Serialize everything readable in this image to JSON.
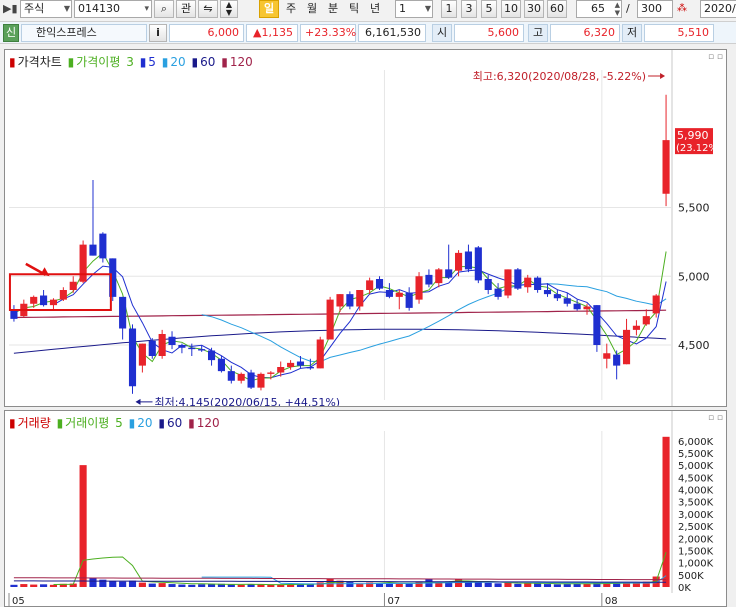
{
  "toolbar": {
    "market_type": "주식",
    "stock_code": "014130",
    "search_btn": "⌕",
    "watch_label": "관",
    "period_day": "일",
    "period_week": "주",
    "period_month": "월",
    "period_minute": "분",
    "period_tick": "틱",
    "period_year": "년",
    "interval_value": "1",
    "interval_options": [
      "1",
      "3",
      "5",
      "10",
      "30",
      "60"
    ],
    "view_count": "65",
    "total_count": "300",
    "date_value": "2020/"
  },
  "infobar": {
    "badge": "신",
    "stock_name": "한익스프레스",
    "info_btn": "i",
    "price": "6,000",
    "change": "▲1,135",
    "change_rate": "+23.33%",
    "volume": "6,161,530",
    "open_label": "시",
    "open_value": "5,600",
    "high_label": "고",
    "high_value": "6,320",
    "low_label": "저",
    "low_value": "5,510"
  },
  "price_panel": {
    "legend_price": "가격차트",
    "legend_ma_name": "가격이평",
    "legend_ma_periods": [
      "3",
      "5",
      "20",
      "60",
      "120"
    ]
  },
  "volume_panel": {
    "legend_volume": "거래량",
    "legend_ma_name": "거래이평",
    "legend_ma_periods": [
      "5",
      "20",
      "60",
      "120"
    ]
  },
  "colors": {
    "up": "#e8232a",
    "down": "#1f2fd0",
    "ma3": "#4caf20",
    "ma5": "#1f2fd0",
    "ma20": "#2aa0e0",
    "ma60": "#1a1a8a",
    "ma120": "#a0234a",
    "annotation": "#c0202a"
  },
  "chart_data": [
    {
      "type": "candlestick",
      "title": "가격차트",
      "yaxis_ticks": [
        "5,500",
        "5,000",
        "4,500"
      ],
      "ylim": [
        4100,
        6500
      ],
      "xaxis_ticks": [
        "05",
        "07",
        "08"
      ],
      "last_price_label": "5,990",
      "last_change_label": "(23.12%)",
      "high_annotation": "최고:6,320(2020/08/28, -5.22%)",
      "low_annotation": "최저:4,145(2020/06/15, +44.51%)",
      "series": [
        {
          "name": "price",
          "ohlc": [
            [
              4760,
              4790,
              4670,
              4690
            ],
            [
              4710,
              4830,
              4700,
              4800
            ],
            [
              4800,
              4860,
              4770,
              4850
            ],
            [
              4860,
              4900,
              4780,
              4790
            ],
            [
              4790,
              4840,
              4760,
              4830
            ],
            [
              4830,
              4920,
              4820,
              4900
            ],
            [
              4900,
              5000,
              4880,
              4960
            ],
            [
              4960,
              5260,
              4950,
              5230
            ],
            [
              5230,
              5700,
              5150,
              5150
            ],
            [
              5310,
              5320,
              5100,
              5130
            ],
            [
              5130,
              5130,
              4820,
              4850
            ],
            [
              4850,
              4850,
              4540,
              4620
            ],
            [
              4620,
              4650,
              4145,
              4200
            ],
            [
              4350,
              4510,
              4300,
              4510
            ],
            [
              4530,
              4550,
              4400,
              4420
            ],
            [
              4420,
              4610,
              4400,
              4580
            ],
            [
              4560,
              4600,
              4470,
              4500
            ],
            [
              4500,
              4510,
              4440,
              4480
            ],
            [
              4480,
              4510,
              4420,
              4470
            ],
            [
              4470,
              4500,
              4450,
              4460
            ],
            [
              4460,
              4480,
              4350,
              4390
            ],
            [
              4400,
              4420,
              4300,
              4310
            ],
            [
              4310,
              4350,
              4220,
              4240
            ],
            [
              4240,
              4300,
              4220,
              4290
            ],
            [
              4300,
              4320,
              4180,
              4190
            ],
            [
              4190,
              4300,
              4170,
              4290
            ],
            [
              4290,
              4310,
              4250,
              4300
            ],
            [
              4300,
              4380,
              4270,
              4340
            ],
            [
              4340,
              4390,
              4320,
              4370
            ],
            [
              4380,
              4420,
              4330,
              4350
            ],
            [
              4340,
              4400,
              4320,
              4330
            ],
            [
              4330,
              4560,
              4330,
              4540
            ],
            [
              4540,
              4850,
              4540,
              4830
            ],
            [
              4780,
              4870,
              4740,
              4870
            ],
            [
              4870,
              4890,
              4760,
              4780
            ],
            [
              4780,
              4900,
              4750,
              4900
            ],
            [
              4900,
              4990,
              4870,
              4970
            ],
            [
              4980,
              5000,
              4900,
              4910
            ],
            [
              4900,
              4950,
              4840,
              4850
            ],
            [
              4850,
              4900,
              4760,
              4880
            ],
            [
              4880,
              4920,
              4750,
              4770
            ],
            [
              4830,
              5030,
              4800,
              5000
            ],
            [
              5010,
              5050,
              4920,
              4940
            ],
            [
              4950,
              5060,
              4920,
              5050
            ],
            [
              5050,
              5230,
              4980,
              4990
            ],
            [
              5040,
              5190,
              5000,
              5170
            ],
            [
              5180,
              5230,
              5030,
              5050
            ],
            [
              5210,
              5220,
              4950,
              4970
            ],
            [
              4980,
              5010,
              4870,
              4900
            ],
            [
              4910,
              4950,
              4830,
              4850
            ],
            [
              4860,
              5050,
              4840,
              5050
            ],
            [
              5050,
              5060,
              4900,
              4910
            ],
            [
              4920,
              5010,
              4880,
              4990
            ],
            [
              4990,
              5000,
              4880,
              4900
            ],
            [
              4900,
              4950,
              4850,
              4870
            ],
            [
              4870,
              4900,
              4820,
              4840
            ],
            [
              4840,
              4880,
              4780,
              4800
            ],
            [
              4800,
              4830,
              4750,
              4760
            ],
            [
              4760,
              4800,
              4720,
              4780
            ],
            [
              4790,
              4790,
              4450,
              4500
            ],
            [
              4400,
              4510,
              4330,
              4440
            ],
            [
              4430,
              4460,
              4250,
              4350
            ],
            [
              4360,
              4690,
              4360,
              4610
            ],
            [
              4610,
              4680,
              4570,
              4640
            ],
            [
              4650,
              4760,
              4640,
              4710
            ],
            [
              4730,
              4870,
              4700,
              4860
            ],
            [
              5600,
              6320,
              5510,
              5990
            ]
          ]
        },
        {
          "name": "3",
          "values": [
            4730,
            4770,
            4780,
            4810,
            4820,
            4840,
            4890,
            5030,
            5110,
            5170,
            5040,
            4870,
            4560,
            4440,
            4380,
            4500,
            4530,
            4520,
            4480,
            4470,
            4440,
            4390,
            4310,
            4280,
            4240,
            4260,
            4260,
            4310,
            4340,
            4350,
            4350,
            4410,
            4570,
            4750,
            4830,
            4850,
            4880,
            4930,
            4910,
            4880,
            4850,
            4880,
            4900,
            4990,
            4990,
            5070,
            5070,
            5060,
            4980,
            4910,
            4930,
            4930,
            4980,
            4930,
            4920,
            4870,
            4840,
            4810,
            4780,
            4680,
            4570,
            4430,
            4470,
            4530,
            4660,
            4740,
            5180
          ]
        }
      ]
    },
    {
      "type": "bar",
      "title": "거래량",
      "yaxis_ticks": [
        "6,000K",
        "5,500K",
        "5,000K",
        "4,500K",
        "4,000K",
        "3,500K",
        "3,000K",
        "2,500K",
        "2,000K",
        "1,500K",
        "1,000K",
        "500K",
        "0K"
      ],
      "ylim": [
        0,
        6400
      ],
      "series": [
        {
          "name": "volume",
          "values": [
            90,
            120,
            100,
            110,
            90,
            130,
            140,
            5000,
            380,
            300,
            250,
            220,
            260,
            180,
            140,
            160,
            120,
            100,
            90,
            110,
            120,
            130,
            100,
            90,
            110,
            100,
            90,
            100,
            110,
            120,
            110,
            190,
            340,
            260,
            200,
            150,
            180,
            160,
            140,
            130,
            140,
            230,
            320,
            170,
            230,
            310,
            210,
            200,
            170,
            150,
            180,
            130,
            160,
            140,
            120,
            110,
            120,
            130,
            140,
            170,
            150,
            140,
            190,
            160,
            220,
            430,
            6162
          ]
        },
        {
          "name": "5",
          "values": [
            null,
            null,
            null,
            null,
            102,
            108,
            112,
            1094,
            1148,
            1190,
            1220,
            1230,
            882,
            242,
            210,
            192,
            172,
            152,
            134,
            132,
            124,
            112,
            106,
            108,
            110,
            106,
            98,
            98,
            102,
            106,
            106,
            126,
            174,
            204,
            226,
            228,
            226,
            208,
            186,
            152,
            150,
            160,
            192,
            198,
            218,
            252,
            248,
            226,
            224,
            208,
            182,
            166,
            158,
            152,
            148,
            132,
            132,
            132,
            130,
            134,
            142,
            146,
            158,
            162,
            172,
            228,
            1432
          ]
        }
      ]
    }
  ]
}
